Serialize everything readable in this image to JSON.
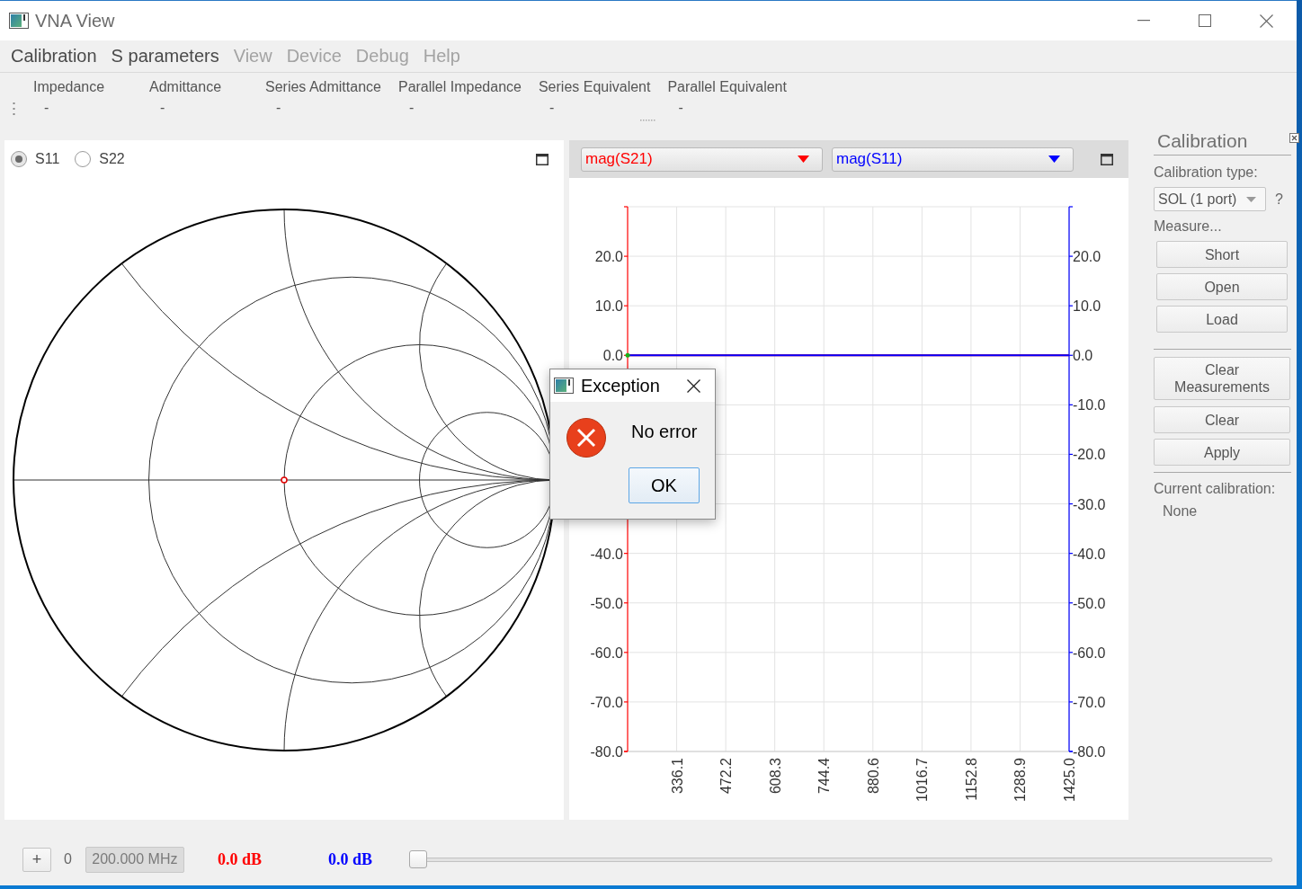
{
  "window": {
    "title": "VNA View"
  },
  "menu": [
    {
      "label": "Calibration",
      "disabled": false
    },
    {
      "label": "S parameters",
      "disabled": false
    },
    {
      "label": "View",
      "disabled": true
    },
    {
      "label": "Device",
      "disabled": true
    },
    {
      "label": "Debug",
      "disabled": true
    },
    {
      "label": "Help",
      "disabled": true
    }
  ],
  "readouts": [
    {
      "label": "Impedance",
      "value": "-"
    },
    {
      "label": "Admittance",
      "value": "-"
    },
    {
      "label": "Series Admittance",
      "value": "-"
    },
    {
      "label": "Parallel Impedance",
      "value": "-"
    },
    {
      "label": "Series Equivalent",
      "value": "-"
    },
    {
      "label": "Parallel Equivalent",
      "value": "-"
    }
  ],
  "smith_panel": {
    "ports": [
      {
        "label": "S11",
        "selected": true
      },
      {
        "label": "S22",
        "selected": false
      }
    ]
  },
  "plot_panel": {
    "chart_data": {
      "type": "line",
      "grid": true,
      "x": [
        200,
        1425
      ],
      "series": [
        {
          "name": "mag(S21)",
          "color": "#ff0000",
          "values": [
            0,
            0
          ]
        },
        {
          "name": "mag(S11)",
          "color": "#0000ff",
          "values": [
            0,
            0
          ]
        }
      ],
      "xlim": [
        200,
        1425
      ],
      "ylim": [
        -80,
        30
      ],
      "xticks": [
        {
          "value": 336.1,
          "label": "336.1"
        },
        {
          "value": 472.2,
          "label": "472.2"
        },
        {
          "value": 608.3,
          "label": "608.3"
        },
        {
          "value": 744.4,
          "label": "744.4"
        },
        {
          "value": 880.6,
          "label": "880.6"
        },
        {
          "value": 1016.7,
          "label": "1016.7"
        },
        {
          "value": 1152.8,
          "label": "1152.8"
        },
        {
          "value": 1288.9,
          "label": "1288.9"
        },
        {
          "value": 1425,
          "label": "1425.0"
        }
      ],
      "yticks": [
        {
          "value": 20,
          "label": "20.0"
        },
        {
          "value": 10,
          "label": "10.0"
        },
        {
          "value": 0,
          "label": "0.0"
        },
        {
          "value": -10,
          "label": "-10.0"
        },
        {
          "value": -20,
          "label": "-20.0"
        },
        {
          "value": -30,
          "label": "-30.0"
        },
        {
          "value": -40,
          "label": "-40.0"
        },
        {
          "value": -50,
          "label": "-50.0"
        },
        {
          "value": -60,
          "label": "-60.0"
        },
        {
          "value": -70,
          "label": "-70.0"
        },
        {
          "value": -80,
          "label": "-80.0"
        }
      ]
    }
  },
  "calibration": {
    "title": "Calibration",
    "type_label": "Calibration type:",
    "type_value": "SOL (1 port)",
    "help": "?",
    "measure_label": "Measure...",
    "measure_buttons": [
      "Short",
      "Open",
      "Load"
    ],
    "action_buttons": [
      "Clear Measurements",
      "Clear",
      "Apply"
    ],
    "current_label": "Current calibration:",
    "current_value": "None"
  },
  "bottom_bar": {
    "add_button": "+",
    "marker_index": "0",
    "frequency": "200.000 MHz",
    "readings": [
      {
        "text": "0.0 dB",
        "color": "#ff0000"
      },
      {
        "text": "0.0 dB",
        "color": "#0000ff"
      }
    ],
    "slider": {
      "level": 0
    }
  },
  "dialog": {
    "title": "Exception",
    "message": "No error",
    "button": "OK"
  }
}
